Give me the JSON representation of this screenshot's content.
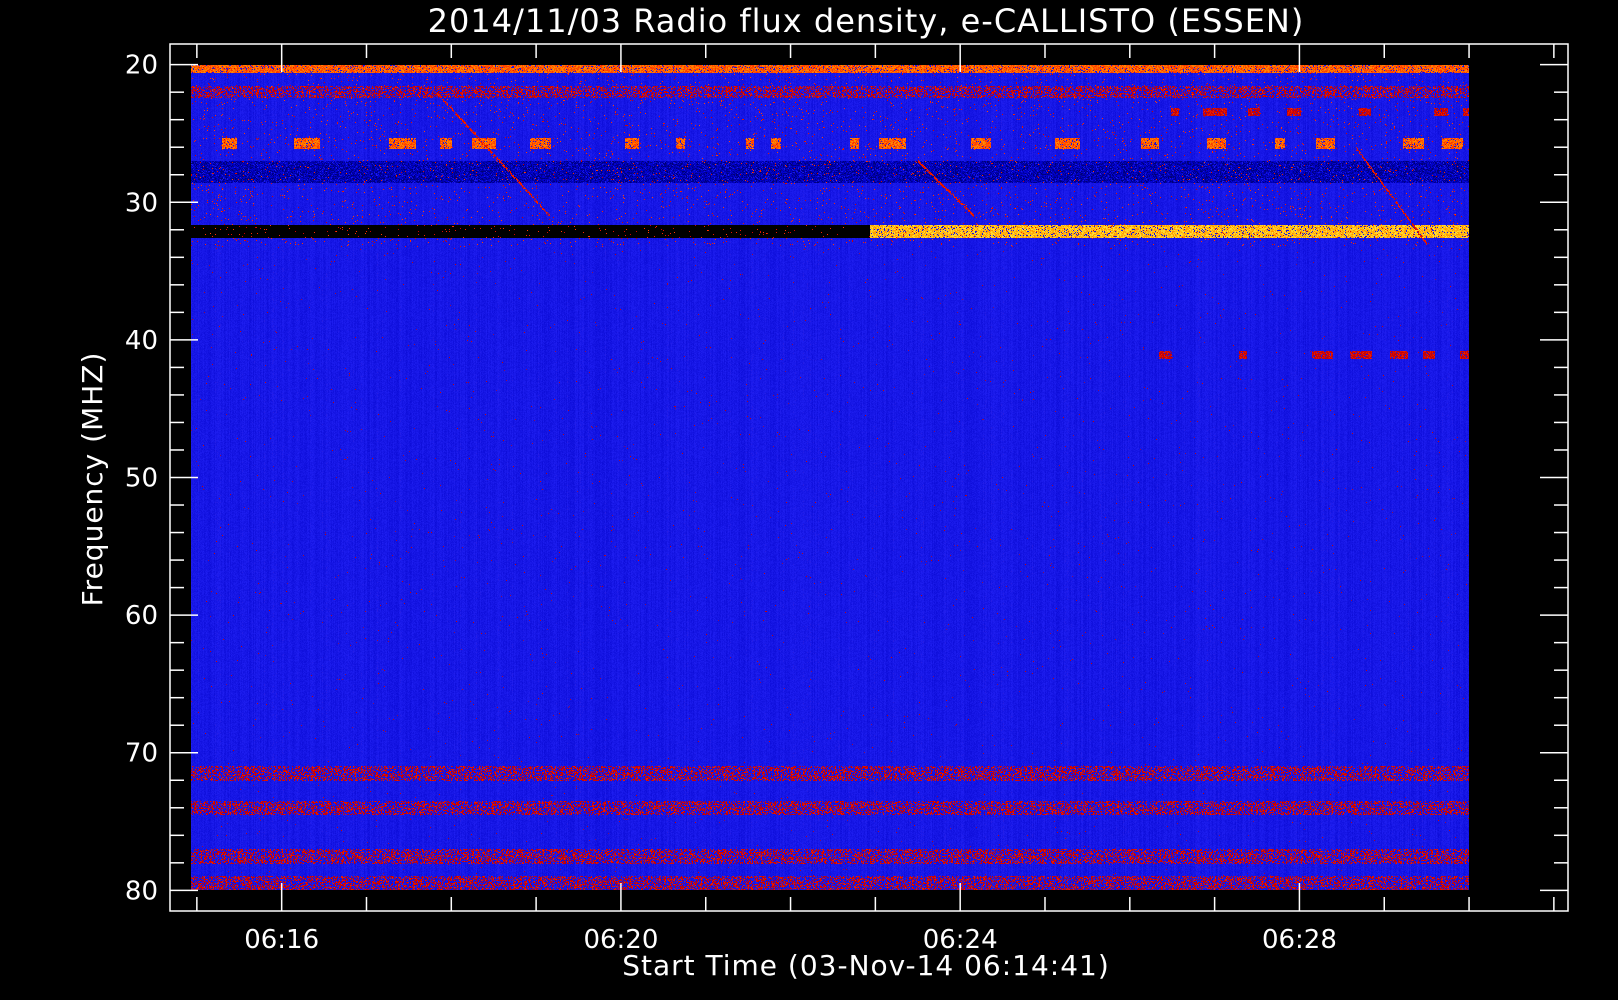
{
  "chart_data": {
    "type": "heatmap",
    "title": "2014/11/03  Radio flux density, e-CALLISTO (ESSEN)",
    "xlabel": "Start Time (03-Nov-14 06:14:41)",
    "ylabel": "Frequency (MHZ)",
    "x_range": [
      "06:14:56",
      "06:30:00"
    ],
    "xlim": [
      "06:14:41",
      "06:31:10"
    ],
    "ylim": [
      81.5,
      18.5
    ],
    "y_axis_inverted": true,
    "x_ticks": [
      "06:16",
      "06:20",
      "06:24",
      "06:28"
    ],
    "y_ticks": [
      20,
      30,
      40,
      50,
      60,
      70,
      80
    ],
    "y_range_mhz": [
      20,
      80
    ],
    "background_level": "low (blue)",
    "colormap": [
      "#000000",
      "#0000c8",
      "#1e1ef0",
      "#c80000",
      "#ff3000",
      "#ffa000",
      "#ffff50"
    ],
    "colors": {
      "background": "#000000",
      "axes": "#ffffff",
      "noise_floor": "#1a1aee",
      "low_signal": "#000040",
      "emission": "#ff2000",
      "strong_emission": "#ffff50"
    },
    "features": [
      {
        "name": "band edge interference",
        "freq_mhz": [
          20,
          20.5
        ],
        "time": [
          "06:14:56",
          "06:30:00"
        ],
        "level": "high"
      },
      {
        "name": "interference band",
        "freq_mhz": [
          21.5,
          22.3
        ],
        "time": [
          "06:14:56",
          "06:30:00"
        ],
        "level": "medium"
      },
      {
        "name": "intermittent carrier",
        "freq_mhz": [
          25.3,
          26
        ],
        "time": [
          "06:14:56",
          "06:30:00"
        ],
        "level": "high, intermittent"
      },
      {
        "name": "dark band",
        "freq_mhz": [
          27,
          28.5
        ],
        "time": [
          "06:14:56",
          "06:30:00"
        ],
        "level": "low"
      },
      {
        "name": "no-signal band",
        "freq_mhz": [
          31.6,
          32.5
        ],
        "time": [
          "06:14:56",
          "06:22:56"
        ],
        "level": "zero"
      },
      {
        "name": "strong carrier",
        "freq_mhz": [
          31.6,
          32.5
        ],
        "time": [
          "06:22:56",
          "06:30:00"
        ],
        "level": "very high"
      },
      {
        "name": "intermittent carrier",
        "freq_mhz": [
          40.8,
          41.3
        ],
        "time": [
          "06:26:10",
          "06:30:00"
        ],
        "level": "medium, intermittent"
      },
      {
        "name": "intermittent carrier",
        "freq_mhz": [
          23.1,
          23.6
        ],
        "time": [
          "06:25:45",
          "06:30:00"
        ],
        "level": "medium, intermittent"
      },
      {
        "name": "noise band",
        "freq_mhz": [
          71,
          72
        ],
        "time": [
          "06:14:56",
          "06:30:00"
        ],
        "level": "medium"
      },
      {
        "name": "noise band",
        "freq_mhz": [
          73.5,
          74.5
        ],
        "time": [
          "06:14:56",
          "06:30:00"
        ],
        "level": "medium"
      },
      {
        "name": "noise band",
        "freq_mhz": [
          77,
          78
        ],
        "time": [
          "06:14:56",
          "06:30:00"
        ],
        "level": "medium"
      },
      {
        "name": "noise band",
        "freq_mhz": [
          79,
          80
        ],
        "time": [
          "06:14:56",
          "06:30:00"
        ],
        "level": "medium"
      },
      {
        "name": "drifting feature",
        "freq_mhz": [
          22,
          31
        ],
        "time": [
          "06:17:50",
          "06:19:10"
        ],
        "level": "medium"
      },
      {
        "name": "drifting feature",
        "freq_mhz": [
          27,
          31
        ],
        "time": [
          "06:23:30",
          "06:24:10"
        ],
        "level": "medium"
      },
      {
        "name": "drifting feature",
        "freq_mhz": [
          26,
          33
        ],
        "time": [
          "06:28:40",
          "06:29:30"
        ],
        "level": "medium"
      }
    ]
  }
}
